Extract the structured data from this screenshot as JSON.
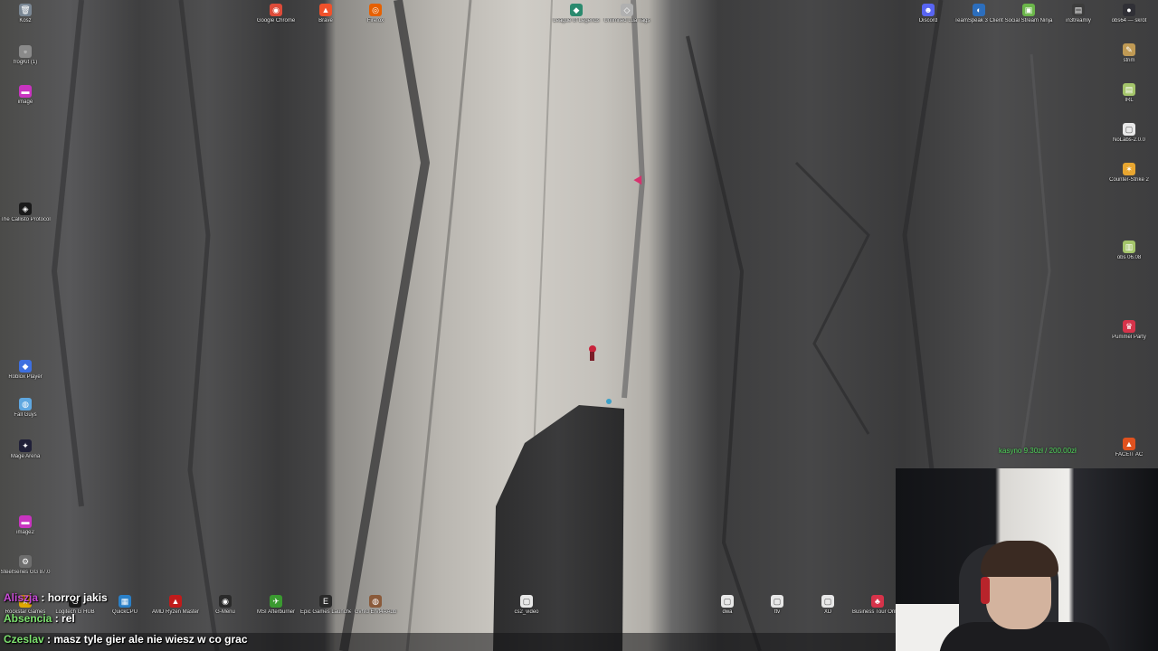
{
  "icons_top": [
    {
      "label": "Kosz",
      "glyph": "🗑",
      "color": "#7a8794"
    },
    {
      "label": "Google Chrome",
      "glyph": "◉",
      "color": "#dd4b39"
    },
    {
      "label": "Brave",
      "glyph": "▲",
      "color": "#f0512b"
    },
    {
      "label": "Firefox",
      "glyph": "◎",
      "color": "#e66000"
    },
    {
      "label": "League of Legends",
      "glyph": "◆",
      "color": "#2b8a6e"
    },
    {
      "label": "Unlimited Lua Tags",
      "glyph": "◇",
      "color": "#b0b0b0"
    },
    {
      "label": "Discord",
      "glyph": "☻",
      "color": "#5865f2"
    },
    {
      "label": "TeamSpeak 3 Client",
      "glyph": "◐",
      "color": "#2c6ebd"
    },
    {
      "label": "Social Stream Ninja",
      "glyph": "▣",
      "color": "#6bb64a"
    },
    {
      "label": "in3treamly",
      "glyph": "▤",
      "color": "#3c3c3c"
    },
    {
      "label": "obs64 — skrót",
      "glyph": "●",
      "color": "#303036"
    }
  ],
  "icons_left": [
    {
      "label": "frogKit (1)",
      "glyph": "▫",
      "color": "#8a8a8a"
    },
    {
      "label": "image",
      "glyph": "▬",
      "color": "#c934c0"
    },
    {
      "label": "The Callisto Protocol",
      "glyph": "◈",
      "color": "#1a1a1a"
    },
    {
      "label": "Roblox Player",
      "glyph": "◆",
      "color": "#3d6fe0"
    },
    {
      "label": "Fall Guys",
      "glyph": "◍",
      "color": "#5fa7e0"
    },
    {
      "label": "Mage Arena",
      "glyph": "✦",
      "color": "#202038"
    },
    {
      "label": "image2",
      "glyph": "▬",
      "color": "#c934c0"
    },
    {
      "label": "SteelSeries GG 87.0",
      "glyph": "⚙",
      "color": "#6e6e6e"
    }
  ],
  "icons_right": [
    {
      "label": "strim",
      "glyph": "✎",
      "color": "#c09a54"
    },
    {
      "label": "IRL",
      "glyph": "▤",
      "color": "#a4c56a"
    },
    {
      "label": "NoLabs-2.0.0",
      "glyph": "▢",
      "color": "#e8e8e8"
    },
    {
      "label": "Counter-Strike 2",
      "glyph": "✶",
      "color": "#e8a630"
    },
    {
      "label": "obs 06.08",
      "glyph": "▥",
      "color": "#a4c56a"
    },
    {
      "label": "Pummel Party",
      "glyph": "♛",
      "color": "#d6334a"
    },
    {
      "label": "FACEIT AC",
      "glyph": "▲",
      "color": "#e0521f"
    }
  ],
  "icons_bottom": [
    {
      "label": "Rockstar Games",
      "glyph": "★",
      "color": "#e0a800"
    },
    {
      "label": "Logitech G HUB",
      "glyph": "G",
      "color": "#1a1a1a"
    },
    {
      "label": "QuickCPU",
      "glyph": "▦",
      "color": "#2a80c8"
    },
    {
      "label": "AMD Ryzen Master",
      "glyph": "▲",
      "color": "#c01b1b"
    },
    {
      "label": "G-Menu",
      "glyph": "◉",
      "color": "#2a2a2a"
    },
    {
      "label": "MSI Afterburner",
      "glyph": "✈",
      "color": "#3a9a30"
    },
    {
      "label": "Epic Games Launcher",
      "glyph": "E",
      "color": "#2a2a2a"
    },
    {
      "label": "Gvhfd Ervt4AAdb",
      "glyph": "◍",
      "color": "#8a5a3a"
    },
    {
      "label": "cs2_video",
      "glyph": "▢",
      "color": "#e8e8e8"
    },
    {
      "label": "dwa",
      "glyph": "▢",
      "color": "#e8e8e8"
    },
    {
      "label": "ttv",
      "glyph": "▢",
      "color": "#e8e8e8"
    },
    {
      "label": "XD",
      "glyph": "▢",
      "color": "#e8e8e8"
    },
    {
      "label": "Business Tour Online Multiplay",
      "glyph": "♣",
      "color": "#d6334a"
    }
  ],
  "money_text": "kasyno 9.30zł / 200.00zł",
  "chat": [
    {
      "user": "Aliszja",
      "sep": ":",
      "text": "horror jakis"
    },
    {
      "user": "Absencia",
      "sep": ":",
      "text": "rel"
    },
    {
      "user": "Czeslav",
      "sep": ":",
      "text": "masz tyle gier ale nie wiesz w co grac"
    }
  ]
}
